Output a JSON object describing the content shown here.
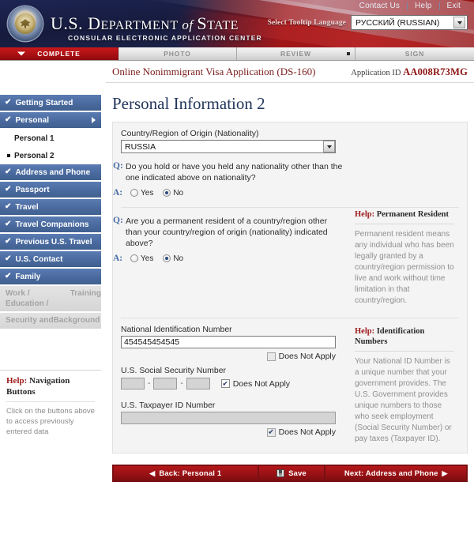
{
  "utility": {
    "links": [
      "Contact Us",
      "Help",
      "Exit"
    ]
  },
  "brand": {
    "title_part1": "U.S. D",
    "title_small1": "EPARTMENT",
    "title_italic": " of ",
    "title_part2": "S",
    "title_small2": "TATE",
    "subtitle": "CONSULAR ELECTRONIC APPLICATION CENTER"
  },
  "language": {
    "label": "Select Tooltip Language",
    "value": "РУССКИЙ (RUSSIAN)",
    "icon": "chevron-down-icon"
  },
  "tabs": [
    {
      "label": "COMPLETE",
      "active": true
    },
    {
      "label": "PHOTO",
      "active": false
    },
    {
      "label": "REVIEW",
      "active": false
    },
    {
      "label": "SIGN",
      "active": false
    }
  ],
  "document": {
    "title": "Online Nonimmigrant Visa Application (DS-160)",
    "appid_label": "Application ID",
    "appid_value": "AA008R73MG"
  },
  "page": {
    "title": "Personal Information 2"
  },
  "sidebar": {
    "items": [
      {
        "label": "Getting Started",
        "state": "complete",
        "checked": true,
        "expanded": false
      },
      {
        "label": "Personal",
        "state": "complete",
        "checked": true,
        "expanded": true
      },
      {
        "label": "Address and Phone",
        "state": "complete",
        "checked": true,
        "expanded": false
      },
      {
        "label": "Passport",
        "state": "complete",
        "checked": true,
        "expanded": false
      },
      {
        "label": "Travel",
        "state": "complete",
        "checked": true,
        "expanded": false
      },
      {
        "label": "Travel Companions",
        "state": "complete",
        "checked": true,
        "expanded": false
      },
      {
        "label": "Previous U.S. Travel",
        "state": "complete",
        "checked": true,
        "expanded": false
      },
      {
        "label": "U.S. Contact",
        "state": "complete",
        "checked": true,
        "expanded": false
      },
      {
        "label": "Family",
        "state": "complete",
        "checked": true,
        "expanded": false
      }
    ],
    "sub_items": [
      {
        "label": "Personal 1",
        "current": false
      },
      {
        "label": "Personal 2",
        "current": true
      }
    ],
    "disabled_items": [
      {
        "line1": "Work / Education /",
        "line2": "Training"
      },
      {
        "line1": "Security and",
        "line2": "Background"
      }
    ],
    "help": {
      "head_word": "Help:",
      "head_rest": " Navigation Buttons",
      "body": "Click on the buttons above to access previously entered data"
    }
  },
  "form": {
    "nationality": {
      "label": "Country/Region of Origin (Nationality)",
      "value": "RUSSIA",
      "icon": "chevron-down-icon"
    },
    "questions": [
      {
        "q_marker": "Q:",
        "a_marker": "A:",
        "text": "Do you hold or have you held any nationality other than the one indicated above on nationality?",
        "options": [
          {
            "label": "Yes",
            "selected": false
          },
          {
            "label": "No",
            "selected": true
          }
        ]
      },
      {
        "q_marker": "Q:",
        "a_marker": "A:",
        "text": "Are you a permanent resident of a country/region other than your country/region of origin (nationality) indicated above?",
        "options": [
          {
            "label": "Yes",
            "selected": false
          },
          {
            "label": "No",
            "selected": true
          }
        ]
      }
    ],
    "national_id": {
      "label": "National Identification Number",
      "value": "454545454545",
      "does_not_apply_label": "Does Not Apply",
      "does_not_apply_checked": false
    },
    "ssn": {
      "label": "U.S. Social Security Number",
      "part1": "",
      "part2": "",
      "part3": "",
      "separator": "-",
      "does_not_apply_label": "Does Not Apply",
      "does_not_apply_checked": true
    },
    "taxpayer": {
      "label": "U.S. Taxpayer ID Number",
      "value": "",
      "does_not_apply_label": "Does Not Apply",
      "does_not_apply_checked": true
    }
  },
  "help_panels": {
    "permanent_resident": {
      "head_word": "Help:",
      "head_rest": " Permanent Resident",
      "body": "Permanent resident means any individual who has been legally granted by a country/region permission to live and work without time limitation in that country/region."
    },
    "identification_numbers": {
      "head_word": "Help:",
      "head_rest": " Identification Numbers",
      "body": "Your National ID Number is a unique number that your government provides. The U.S. Government provides unique numbers to those who seek employment (Social Security Number) or pay taxes (Taxpayer ID)."
    }
  },
  "buttons": {
    "back": "Back: Personal 1",
    "back_caret": "◀",
    "save": "Save",
    "save_icon": "floppy-disk-icon",
    "next": "Next: Address and Phone",
    "next_caret": "▶"
  },
  "colors": {
    "accent_red": "#9e1b1b",
    "nav_blue": "#4a6a9f",
    "tab_active_red": "#ab1013",
    "title_navy": "#23365c"
  }
}
